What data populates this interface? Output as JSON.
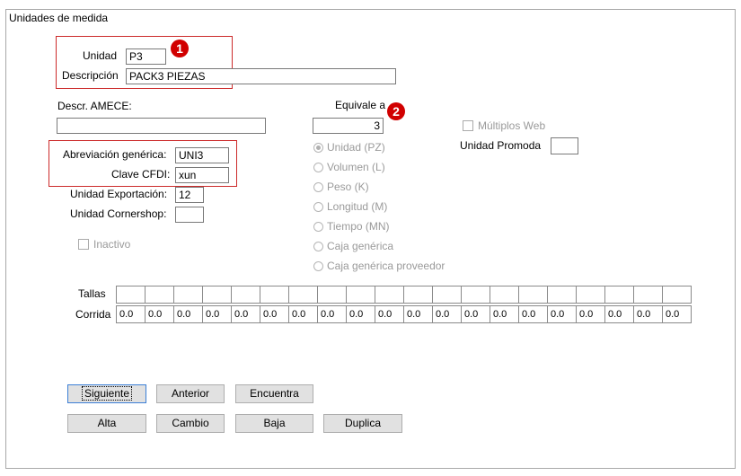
{
  "window": {
    "title": "Unidades de medida"
  },
  "fields": {
    "unidad": {
      "label": "Unidad",
      "value": "P3"
    },
    "descripcion": {
      "label": "Descripción",
      "value": "PACK3 PIEZAS"
    },
    "descr_amece": {
      "label": "Descr. AMECE:",
      "value": ""
    },
    "abreviacion": {
      "label": "Abreviación genérica:",
      "value": "UNI3"
    },
    "clave_cfdi": {
      "label": "Clave CFDI:",
      "value": "xun"
    },
    "unidad_exportacion": {
      "label": "Unidad Exportación:",
      "value": "12"
    },
    "unidad_cornershop": {
      "label": "Unidad Cornershop:",
      "value": ""
    },
    "equivale": {
      "label": "Equivale a",
      "value": "3"
    },
    "unidad_promoda": {
      "label": "Unidad Promoda",
      "value": ""
    }
  },
  "checkboxes": {
    "inactivo": {
      "label": "Inactivo",
      "checked": false
    },
    "multiplos_web": {
      "label": "Múltiplos Web",
      "checked": false
    }
  },
  "radio_group": {
    "selected": "Unidad (PZ)",
    "options": [
      "Unidad (PZ)",
      "Volumen (L)",
      "Peso (K)",
      "Longitud (M)",
      "Tiempo (MN)",
      "Caja genérica",
      "Caja genérica proveedor"
    ]
  },
  "grid": {
    "tallas_label": "Tallas",
    "corrida_label": "Corrida",
    "tallas": [
      "",
      "",
      "",
      "",
      "",
      "",
      "",
      "",
      "",
      "",
      "",
      "",
      "",
      "",
      "",
      "",
      "",
      "",
      "",
      ""
    ],
    "corrida": [
      "0.0",
      "0.0",
      "0.0",
      "0.0",
      "0.0",
      "0.0",
      "0.0",
      "0.0",
      "0.0",
      "0.0",
      "0.0",
      "0.0",
      "0.0",
      "0.0",
      "0.0",
      "0.0",
      "0.0",
      "0.0",
      "0.0",
      "0.0"
    ]
  },
  "buttons": {
    "siguiente": "Siguiente",
    "anterior": "Anterior",
    "encuentra": "Encuentra",
    "alta": "Alta",
    "cambio": "Cambio",
    "baja": "Baja",
    "duplica": "Duplica"
  },
  "annotations": {
    "badge1": "1",
    "badge2": "2",
    "color": "#d10000"
  }
}
